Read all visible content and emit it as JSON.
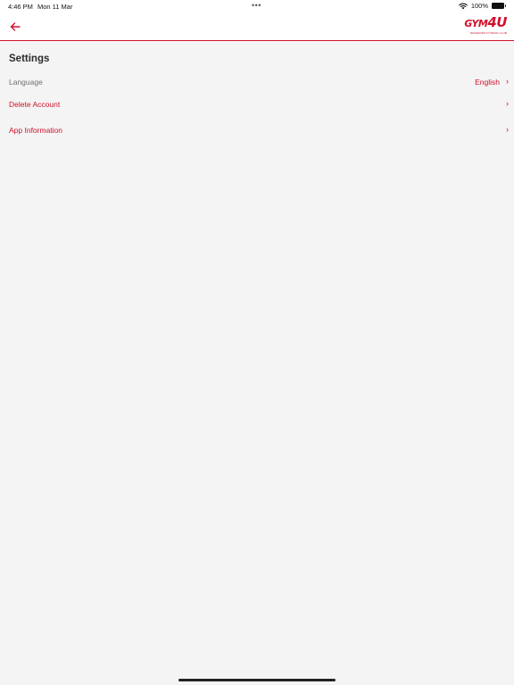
{
  "status_bar": {
    "time": "4:46 PM",
    "date": "Mon 11 Mar",
    "dots": "•••",
    "battery": "100%"
  },
  "nav": {
    "back_icon": "arrow-left-icon",
    "logo": {
      "text_main": "GYM",
      "text_accent": "4U",
      "tagline": "RESERVED FITNESS CLUB"
    }
  },
  "page": {
    "title": "Settings"
  },
  "settings": {
    "language": {
      "label": "Language",
      "value": "English"
    },
    "delete_account": {
      "label": "Delete Account"
    },
    "app_information": {
      "label": "App Information"
    }
  },
  "colors": {
    "accent": "#d0102b",
    "background": "#f4f4f4",
    "header": "#ffffff"
  }
}
